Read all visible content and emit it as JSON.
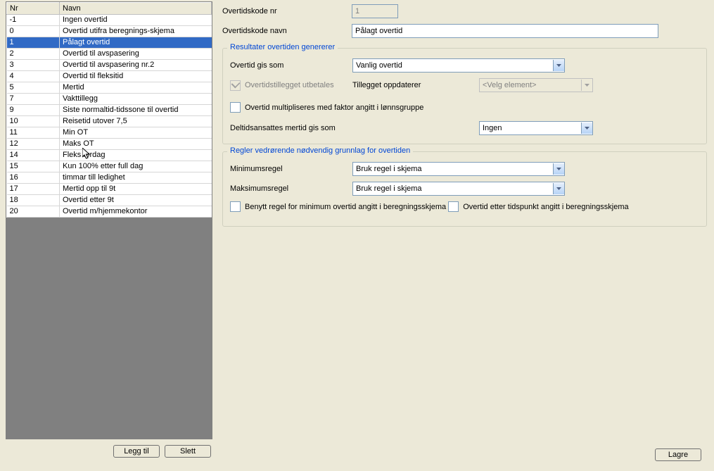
{
  "grid": {
    "headers": {
      "nr": "Nr",
      "navn": "Navn"
    },
    "rows": [
      {
        "nr": "-1",
        "navn": "Ingen overtid",
        "selected": false
      },
      {
        "nr": "0",
        "navn": "Overtid utifra beregnings-skjema",
        "selected": false
      },
      {
        "nr": "1",
        "navn": "Pålagt overtid",
        "selected": true
      },
      {
        "nr": "2",
        "navn": "Overtid til avspasering",
        "selected": false
      },
      {
        "nr": "3",
        "navn": "Overtid til avspasering nr.2",
        "selected": false
      },
      {
        "nr": "4",
        "navn": "Overtid til fleksitid",
        "selected": false
      },
      {
        "nr": "5",
        "navn": "Mertid",
        "selected": false
      },
      {
        "nr": "7",
        "navn": "Vakttillegg",
        "selected": false
      },
      {
        "nr": "9",
        "navn": "Siste normaltid-tidssone til overtid",
        "selected": false
      },
      {
        "nr": "10",
        "navn": "Reisetid utover 7,5",
        "selected": false
      },
      {
        "nr": "11",
        "navn": "Min OT",
        "selected": false
      },
      {
        "nr": "12",
        "navn": "Maks OT",
        "selected": false
      },
      {
        "nr": "14",
        "navn": "Fleks lørdag",
        "selected": false
      },
      {
        "nr": "15",
        "navn": "Kun 100% etter full dag",
        "selected": false
      },
      {
        "nr": "16",
        "navn": "timmar till ledighet",
        "selected": false
      },
      {
        "nr": "17",
        "navn": "Mertid opp til 9t",
        "selected": false
      },
      {
        "nr": "18",
        "navn": "Overtid etter 9t",
        "selected": false
      },
      {
        "nr": "20",
        "navn": "Overtid m/hjemmekontor",
        "selected": false
      }
    ]
  },
  "buttons": {
    "add": "Legg til",
    "delete": "Slett",
    "save": "Lagre"
  },
  "form": {
    "id_label": "Overtidskode nr",
    "id_value": "1",
    "name_label": "Overtidskode navn",
    "name_value": "Pålagt overtid"
  },
  "group_results": {
    "legend": "Resultater overtiden genererer",
    "overtime_as_label": "Overtid gis som",
    "overtime_as_value": "Vanlig overtid",
    "paid_checkbox_label": "Overtidstillegget utbetales",
    "update_label": "Tillegget oppdaterer",
    "update_value": "<Velg element>",
    "multiply_checkbox_label": "Overtid multipliseres med faktor angitt i lønnsgruppe",
    "parttime_label": "Deltidsansattes mertid gis som",
    "parttime_value": "Ingen"
  },
  "group_rules": {
    "legend": "Regler vedrørende nødvendig grunnlag for overtiden",
    "min_label": "Minimumsregel",
    "min_value": "Bruk regel i skjema",
    "max_label": "Maksimumsregel",
    "max_value": "Bruk regel i skjema",
    "cb1": "Benytt regel for minimum overtid angitt i beregningsskjema",
    "cb2": "Overtid etter tidspunkt angitt i beregningsskjema"
  }
}
